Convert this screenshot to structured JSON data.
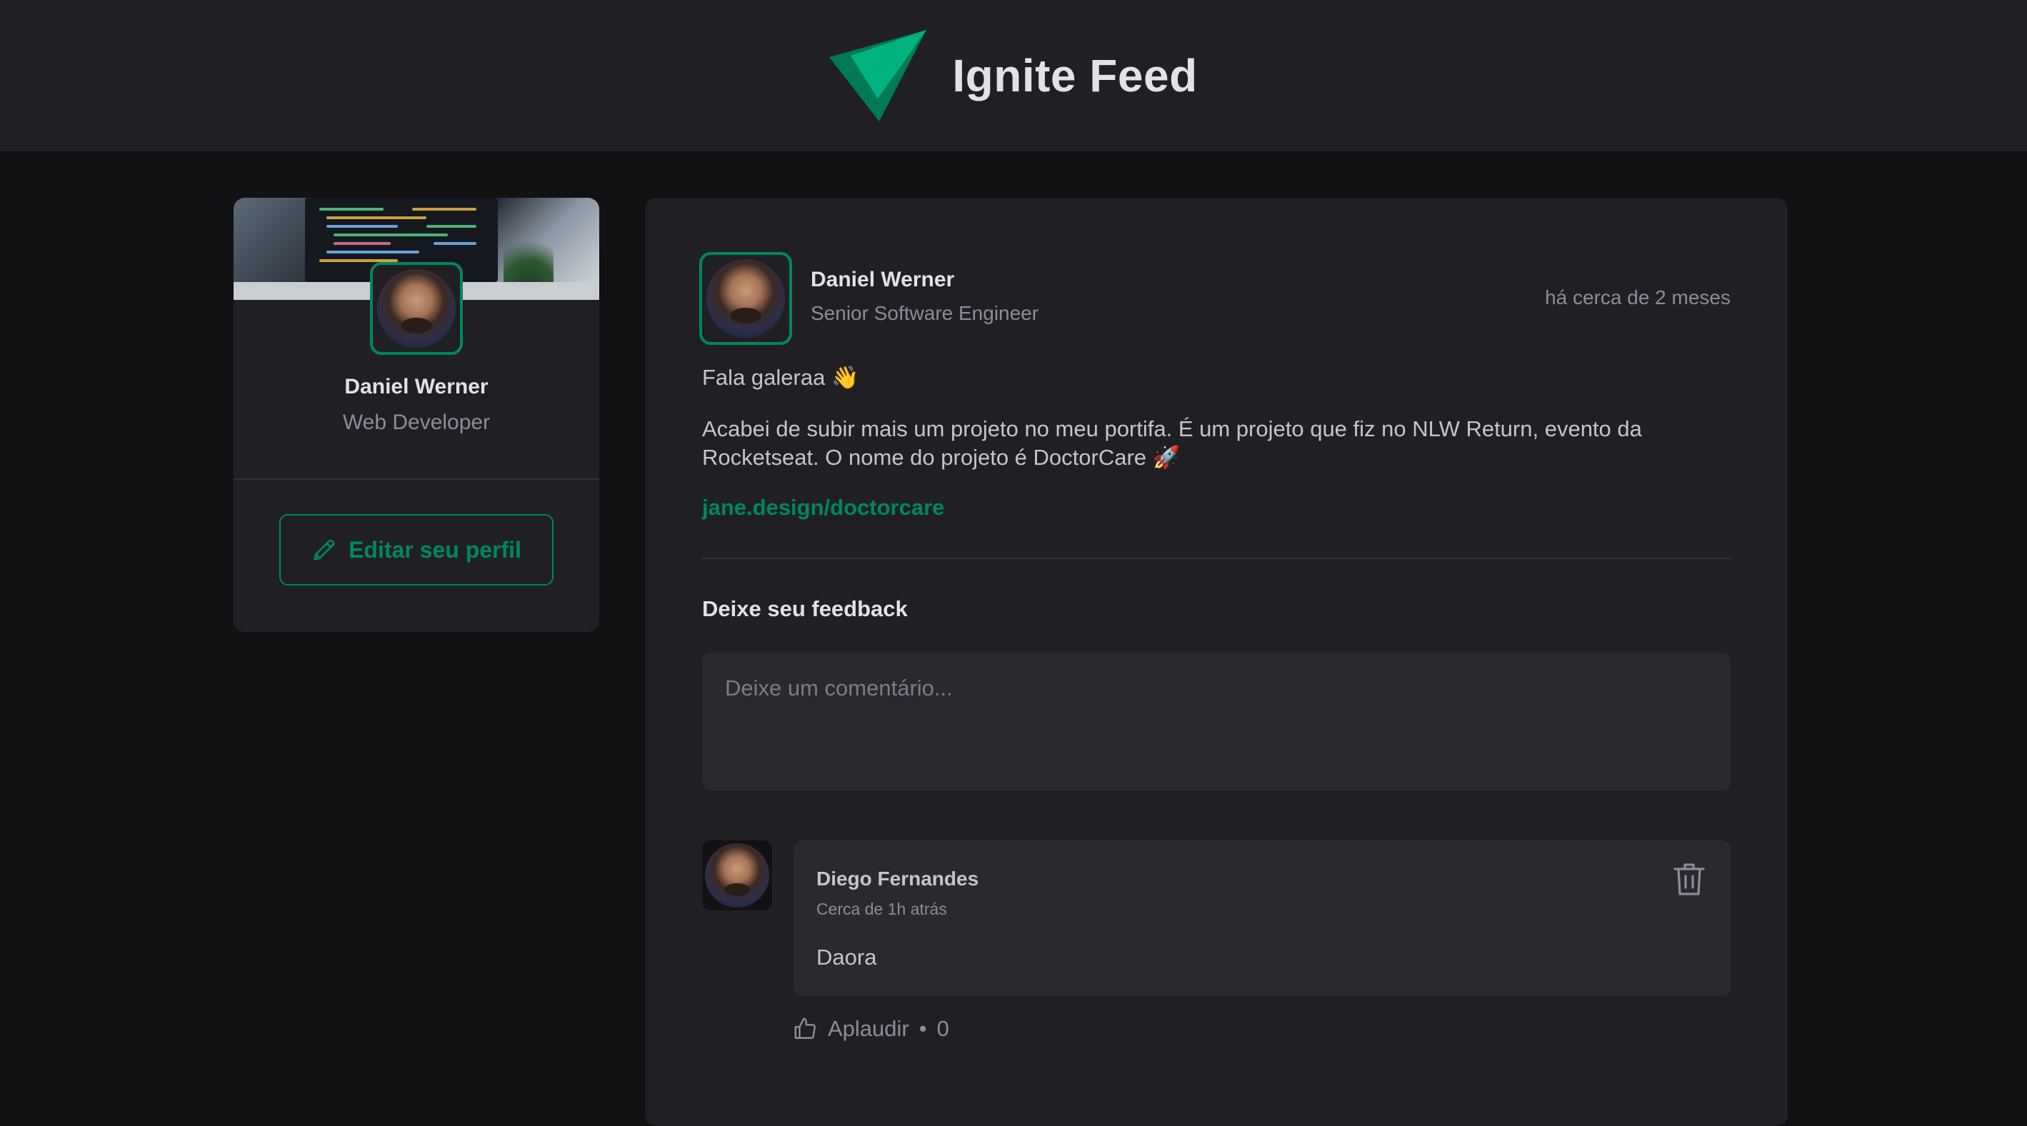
{
  "app": {
    "title": "Ignite Feed"
  },
  "sidebar": {
    "name": "Daniel Werner",
    "role": "Web Developer",
    "edit_label": "Editar seu perfil"
  },
  "post": {
    "author": {
      "name": "Daniel Werner",
      "role": "Senior Software Engineer"
    },
    "time": "há cerca de 2 meses",
    "content": [
      "Fala galeraa 👋",
      "Acabei de subir mais um projeto no meu portifa. É um projeto que fiz no NLW Return, evento da Rocketseat. O nome do projeto é DoctorCare 🚀"
    ],
    "link": "jane.design/doctorcare",
    "feedback_title": "Deixe seu feedback",
    "comment_placeholder": "Deixe um comentário..."
  },
  "comments": [
    {
      "author": "Diego Fernandes",
      "time": "Cerca de 1h atrás",
      "text": "Daora",
      "applaud_label": "Aplaudir",
      "applaud_count": "0"
    }
  ],
  "colors": {
    "accent": "#00875f",
    "bg": "#121214",
    "surface": "#202024"
  }
}
